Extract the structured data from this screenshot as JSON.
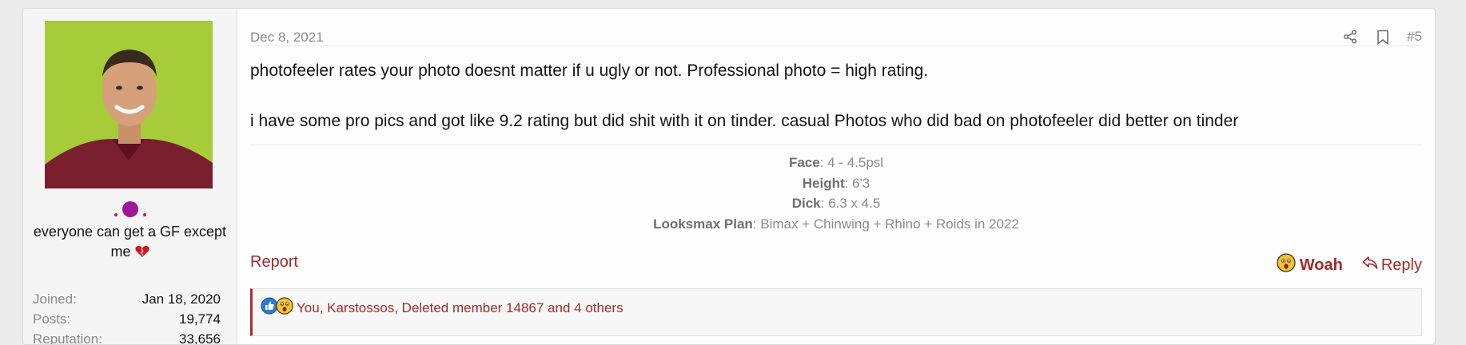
{
  "user": {
    "title": "everyone can get a GF except me",
    "extras": [
      {
        "label": "Joined:",
        "value": "Jan 18, 2020"
      },
      {
        "label": "Posts:",
        "value": "19,774"
      },
      {
        "label": "Reputation:",
        "value": "33,656"
      }
    ]
  },
  "post": {
    "date": "Dec 8, 2021",
    "number": "#5",
    "paragraphs": [
      "photofeeler rates your photo doesnt matter if u ugly or not. Professional photo = high rating.",
      "i have some pro pics and got like 9.2 rating but did shit with it on tinder. casual Photos who did bad on photofeeler did better on tinder"
    ]
  },
  "signature": [
    {
      "label": "Face",
      "value": ": 4 - 4.5psl"
    },
    {
      "label": "Height",
      "value": ": 6'3"
    },
    {
      "label": "Dick",
      "value": ": 6.3 x 4.5"
    },
    {
      "label": "Looksmax Plan",
      "value": ": Bimax + Chinwing + Rhino + Roids in 2022"
    }
  ],
  "footer": {
    "report_label": "Report",
    "reaction_label": "Woah",
    "reply_label": "Reply"
  },
  "reactions": {
    "text": "You, Karstossos, Deleted member 14867 and 4 others"
  },
  "colors": {
    "accent": "#a12b2b",
    "muted": "#8a8a8a",
    "user_panel": "#f5f5f5",
    "avatar_bg": "#a6cc3a"
  },
  "icons": [
    "share-icon",
    "bookmark-icon",
    "woah-emoji-icon",
    "reply-icon",
    "like-reaction-icon",
    "heart-icon",
    "red-heart-icon"
  ]
}
